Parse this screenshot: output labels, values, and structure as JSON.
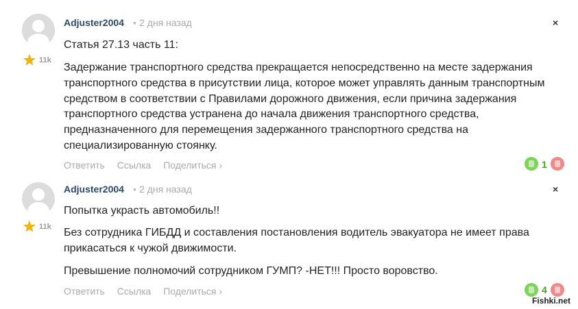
{
  "comments": [
    {
      "author": "Adjuster2004",
      "separator": "•",
      "time": "2 дня назад",
      "rating": "11k",
      "paragraphs": [
        "Статья 27.13 часть 11:",
        "Задержание транспортного средства прекращается непосредственно на месте задержания транспортного средства в присутствии лица, которое может управлять данным транспортным средством в соответствии с Правилами дорожного движения, если причина задержания транспортного средства устранена до начала движения транспортного средства, предназначенного для перемещения задержанного транспортного средства на специализированную стоянку."
      ],
      "actions": {
        "reply": "Ответить",
        "link": "Ссылка",
        "share": "Поделиться ›"
      },
      "votes": "1",
      "close": "×"
    },
    {
      "author": "Adjuster2004",
      "separator": "•",
      "time": "2 дня назад",
      "rating": "11k",
      "paragraphs": [
        "Попытка украсть автомобиль!!",
        "Без сотрудника ГИБДД и составления постановления водитель эвакуатора не имеет права прикасаться к чужой движимости.",
        "Превышение полномочий сотрудником ГУМП? -НЕТ!!! Просто воровство."
      ],
      "actions": {
        "reply": "Ответить",
        "link": "Ссылка",
        "share": "Поделиться ›"
      },
      "votes": "4",
      "close": "×"
    }
  ],
  "watermark": "Fishki.net",
  "colors": {
    "author": "#2b4a66",
    "muted": "#aaaaaa",
    "vote_up": "#7ed35a",
    "vote_down": "#f08a8a",
    "vote_count": "#45a31c"
  },
  "icons": {
    "avatar": "default-user-avatar",
    "rating": "star-icon",
    "close": "close-icon",
    "vote_up": "thumb-up-icon",
    "vote_down": "thumb-down-icon"
  }
}
